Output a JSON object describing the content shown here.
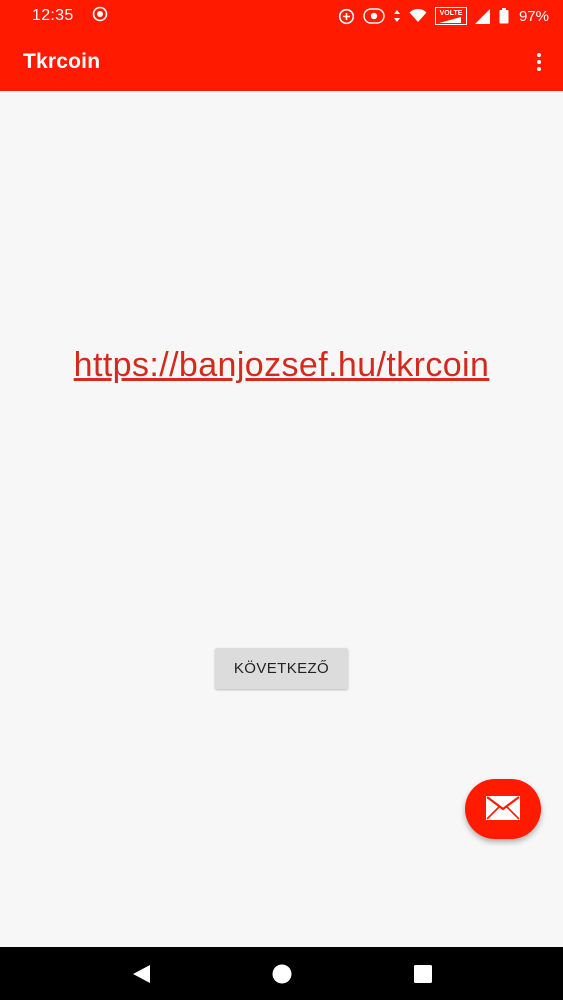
{
  "status_bar": {
    "time": "12:35",
    "network_label": "VOLTE",
    "battery": "97%"
  },
  "app_bar": {
    "title": "Tkrcoin",
    "overflow_icon": "more-vert-icon"
  },
  "main": {
    "link_text": "https://banjozsef.hu/tkrcoin",
    "next_button_label": "KÖVETKEZŐ"
  },
  "fab": {
    "icon": "mail-icon"
  },
  "nav_bar": {
    "back_icon": "back-icon",
    "home_icon": "home-icon",
    "recents_icon": "recents-icon"
  },
  "colors": {
    "primary": "#ff1a00",
    "link": "#d42a1c",
    "background": "#f7f7f7",
    "button": "#dcdcdc"
  }
}
